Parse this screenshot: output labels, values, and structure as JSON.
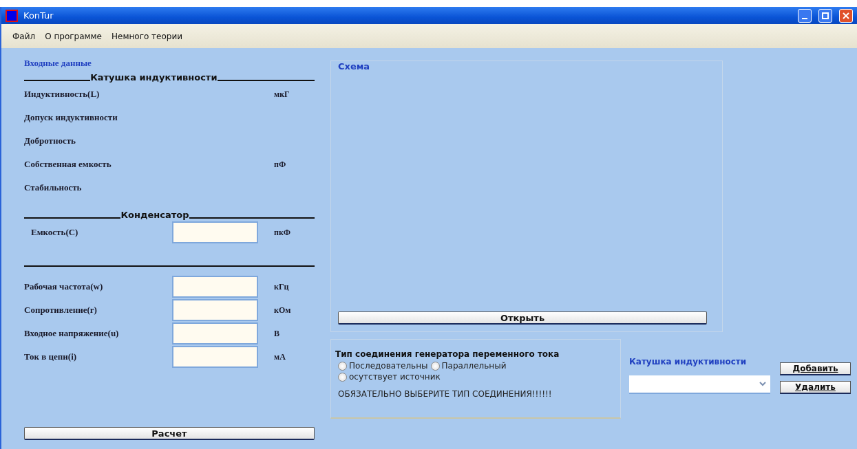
{
  "window": {
    "title": "KonTur"
  },
  "menu": [
    "Файл",
    "О программе",
    "Немного теории"
  ],
  "input_panel": {
    "title": "Входные данные",
    "coil_heading": "Катушка индуктивности",
    "coil_rows": [
      {
        "label": "Индуктивность(L)",
        "unit": "мкГ"
      },
      {
        "label": "Допуск индуктивности"
      },
      {
        "label": "Добротность"
      },
      {
        "label": "Собственная емкость",
        "unit": "пФ"
      },
      {
        "label": "Стабильность"
      }
    ],
    "capacitor_heading": "Конденсатор",
    "capacitor_rows": [
      {
        "label": "Емкость(C)",
        "unit": "пкФ"
      }
    ],
    "circuit_rows": [
      {
        "label": "Рабочая частота(w)",
        "unit": "кГц"
      },
      {
        "label": "Сопротивление(r)",
        "unit": "кОм"
      },
      {
        "label": "Входное напряжение(u)",
        "unit": "В"
      },
      {
        "label": "Ток в цепи(i)",
        "unit": "мА"
      }
    ],
    "calc_button": "Расчет"
  },
  "schema": {
    "title": "Схема",
    "open_button": "Открыть"
  },
  "connection": {
    "title": "Тип соединения генератора переменного тока",
    "options": [
      {
        "label": "Последовательны",
        "selected": false
      },
      {
        "label": "Параллельный",
        "selected": false
      },
      {
        "label": "осутствует источник",
        "selected": false
      }
    ],
    "warning": "ОБЯЗАТЕЛЬНО ВЫБЕРИТЕ ТИП СОЕДИНЕНИЯ!!!!!!"
  },
  "coil_selector": {
    "label": "Катушка индуктивности",
    "add_button": "Добавить",
    "remove_button": "Удалить"
  }
}
